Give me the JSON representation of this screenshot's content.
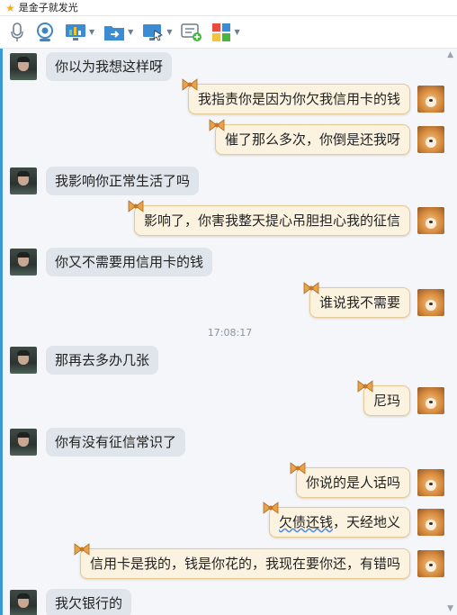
{
  "window": {
    "title": "是金子就发光"
  },
  "toolbar": {
    "icons": [
      "microphone-icon",
      "video-icon",
      "screen-share-icon",
      "file-transfer-icon",
      "remote-desktop-icon",
      "message-add-icon",
      "apps-icon"
    ]
  },
  "colors": {
    "accent": "#3a97d8",
    "incoming_bubble": "#e0e4eb",
    "outgoing_bubble": "#fbf3e0"
  },
  "chat": {
    "timestamp": "17:08:17",
    "messages": [
      {
        "side": "left",
        "text": "你以为我想这样呀"
      },
      {
        "side": "right",
        "text": "我指责你是因为你欠我信用卡的钱"
      },
      {
        "side": "right",
        "text": "催了那么多次，你倒是还我呀"
      },
      {
        "side": "left",
        "text": "我影响你正常生活了吗"
      },
      {
        "side": "right",
        "text": "影响了，你害我整天提心吊胆担心我的征信"
      },
      {
        "side": "left",
        "text": "你又不需要用信用卡的钱"
      },
      {
        "side": "right",
        "text": "谁说我不需要"
      },
      {
        "side": "left",
        "text": "那再去多办几张"
      },
      {
        "side": "right",
        "text": "尼玛"
      },
      {
        "side": "left",
        "text": "你有没有征信常识了"
      },
      {
        "side": "right",
        "text": "你说的是人话吗"
      },
      {
        "side": "right",
        "text_underlined": "欠债还钱",
        "text_rest": "，天经地义"
      },
      {
        "side": "right",
        "text": "信用卡是我的，钱是你花的，我现在要你还，有错吗"
      },
      {
        "side": "left",
        "text": "我欠银行的"
      }
    ]
  }
}
